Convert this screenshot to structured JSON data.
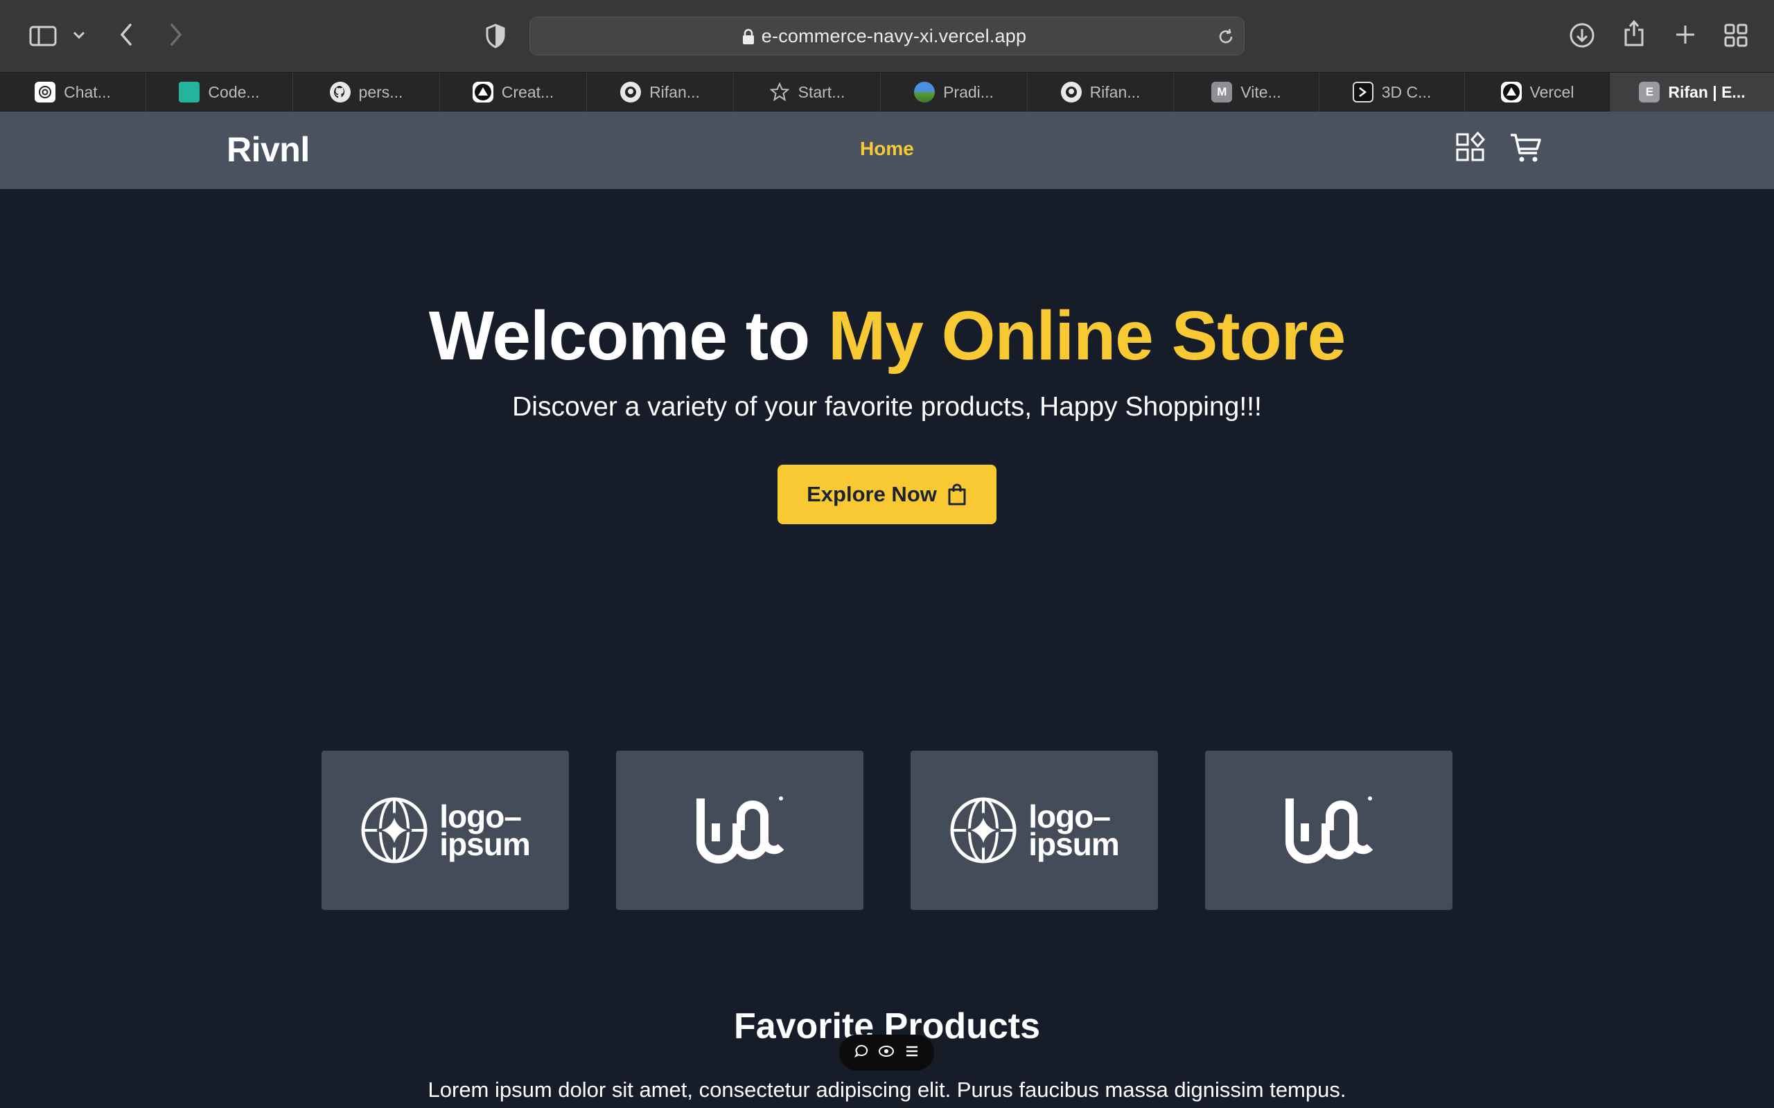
{
  "browser": {
    "url": "e-commerce-navy-xi.vercel.app",
    "tabs": [
      {
        "label": "Chat...",
        "icon": "chatgpt-icon"
      },
      {
        "label": "Code...",
        "icon": "teal-square-icon"
      },
      {
        "label": "pers...",
        "icon": "github-icon"
      },
      {
        "label": "Creat...",
        "icon": "vercel-icon"
      },
      {
        "label": "Rifan...",
        "icon": "github-icon"
      },
      {
        "label": "Start...",
        "icon": "star-icon"
      },
      {
        "label": "Pradi...",
        "icon": "landscape-icon"
      },
      {
        "label": "Rifan...",
        "icon": "github-icon"
      },
      {
        "label": "Vite...",
        "icon": "letter-m-icon",
        "letter": "M"
      },
      {
        "label": "3D C...",
        "icon": "terminal-icon"
      },
      {
        "label": "Vercel",
        "icon": "vercel-icon"
      },
      {
        "label": "Rifan | E...",
        "icon": "letter-e-icon",
        "letter": "E",
        "active": true
      }
    ]
  },
  "navbar": {
    "brand": "Rivnl",
    "home_label": "Home"
  },
  "hero": {
    "title_prefix": "Welcome to ",
    "title_accent": "My Online Store",
    "subtitle": "Discover a variety of your favorite products, Happy Shopping!!!",
    "cta_label": "Explore Now"
  },
  "logos": [
    {
      "type": "logo-ipsum",
      "line1": "logo–",
      "line2": "ipsum"
    },
    {
      "type": "logo-mark"
    },
    {
      "type": "logo-ipsum",
      "line1": "logo–",
      "line2": "ipsum"
    },
    {
      "type": "logo-mark"
    }
  ],
  "favorites": {
    "title": "Favorite Products",
    "text": "Lorem ipsum dolor sit amet, consectetur adipiscing elit. Purus faucibus massa dignissim tempus."
  },
  "colors": {
    "accent": "#f8c932",
    "page_bg": "#161d29",
    "navbar_bg": "#4a5260",
    "card_bg": "#454c59"
  }
}
